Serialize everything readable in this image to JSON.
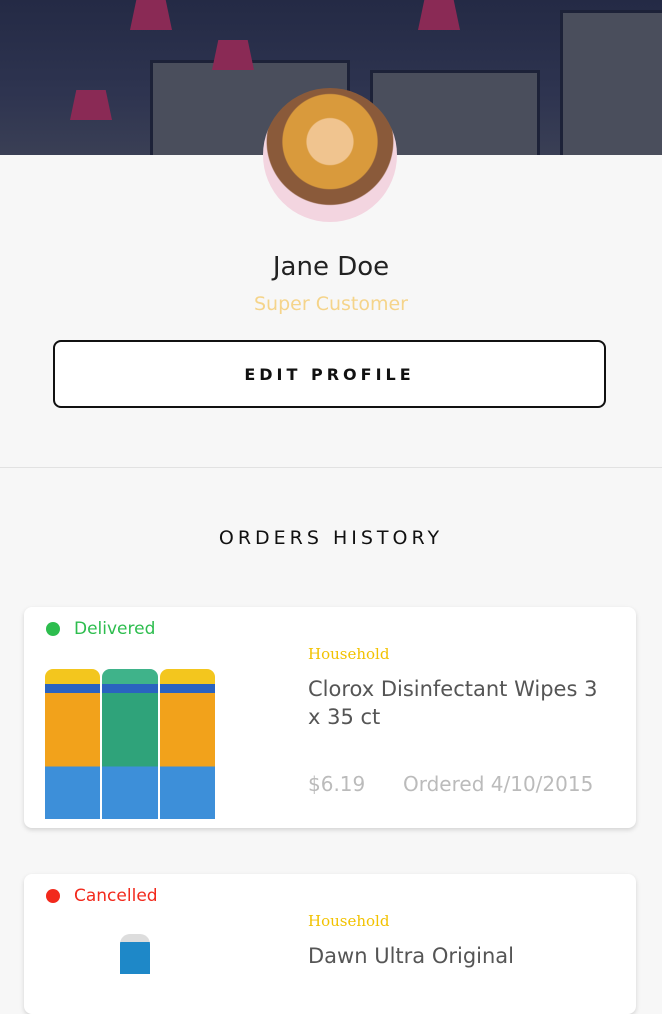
{
  "profile": {
    "name": "Jane Doe",
    "subtitle": "Super Customer",
    "edit_label": "EDIT PROFILE"
  },
  "orders": {
    "heading": "ORDERS HISTORY",
    "items": [
      {
        "status": "Delivered",
        "status_color": "#2dbd4e",
        "category": "Household",
        "title": "Clorox Disinfectant Wipes 3 x 35 ct",
        "price": "$6.19",
        "ordered": "Ordered 4/10/2015"
      },
      {
        "status": "Cancelled",
        "status_color": "#f2291c",
        "category": "Household",
        "title": "Dawn Ultra Original"
      }
    ]
  }
}
